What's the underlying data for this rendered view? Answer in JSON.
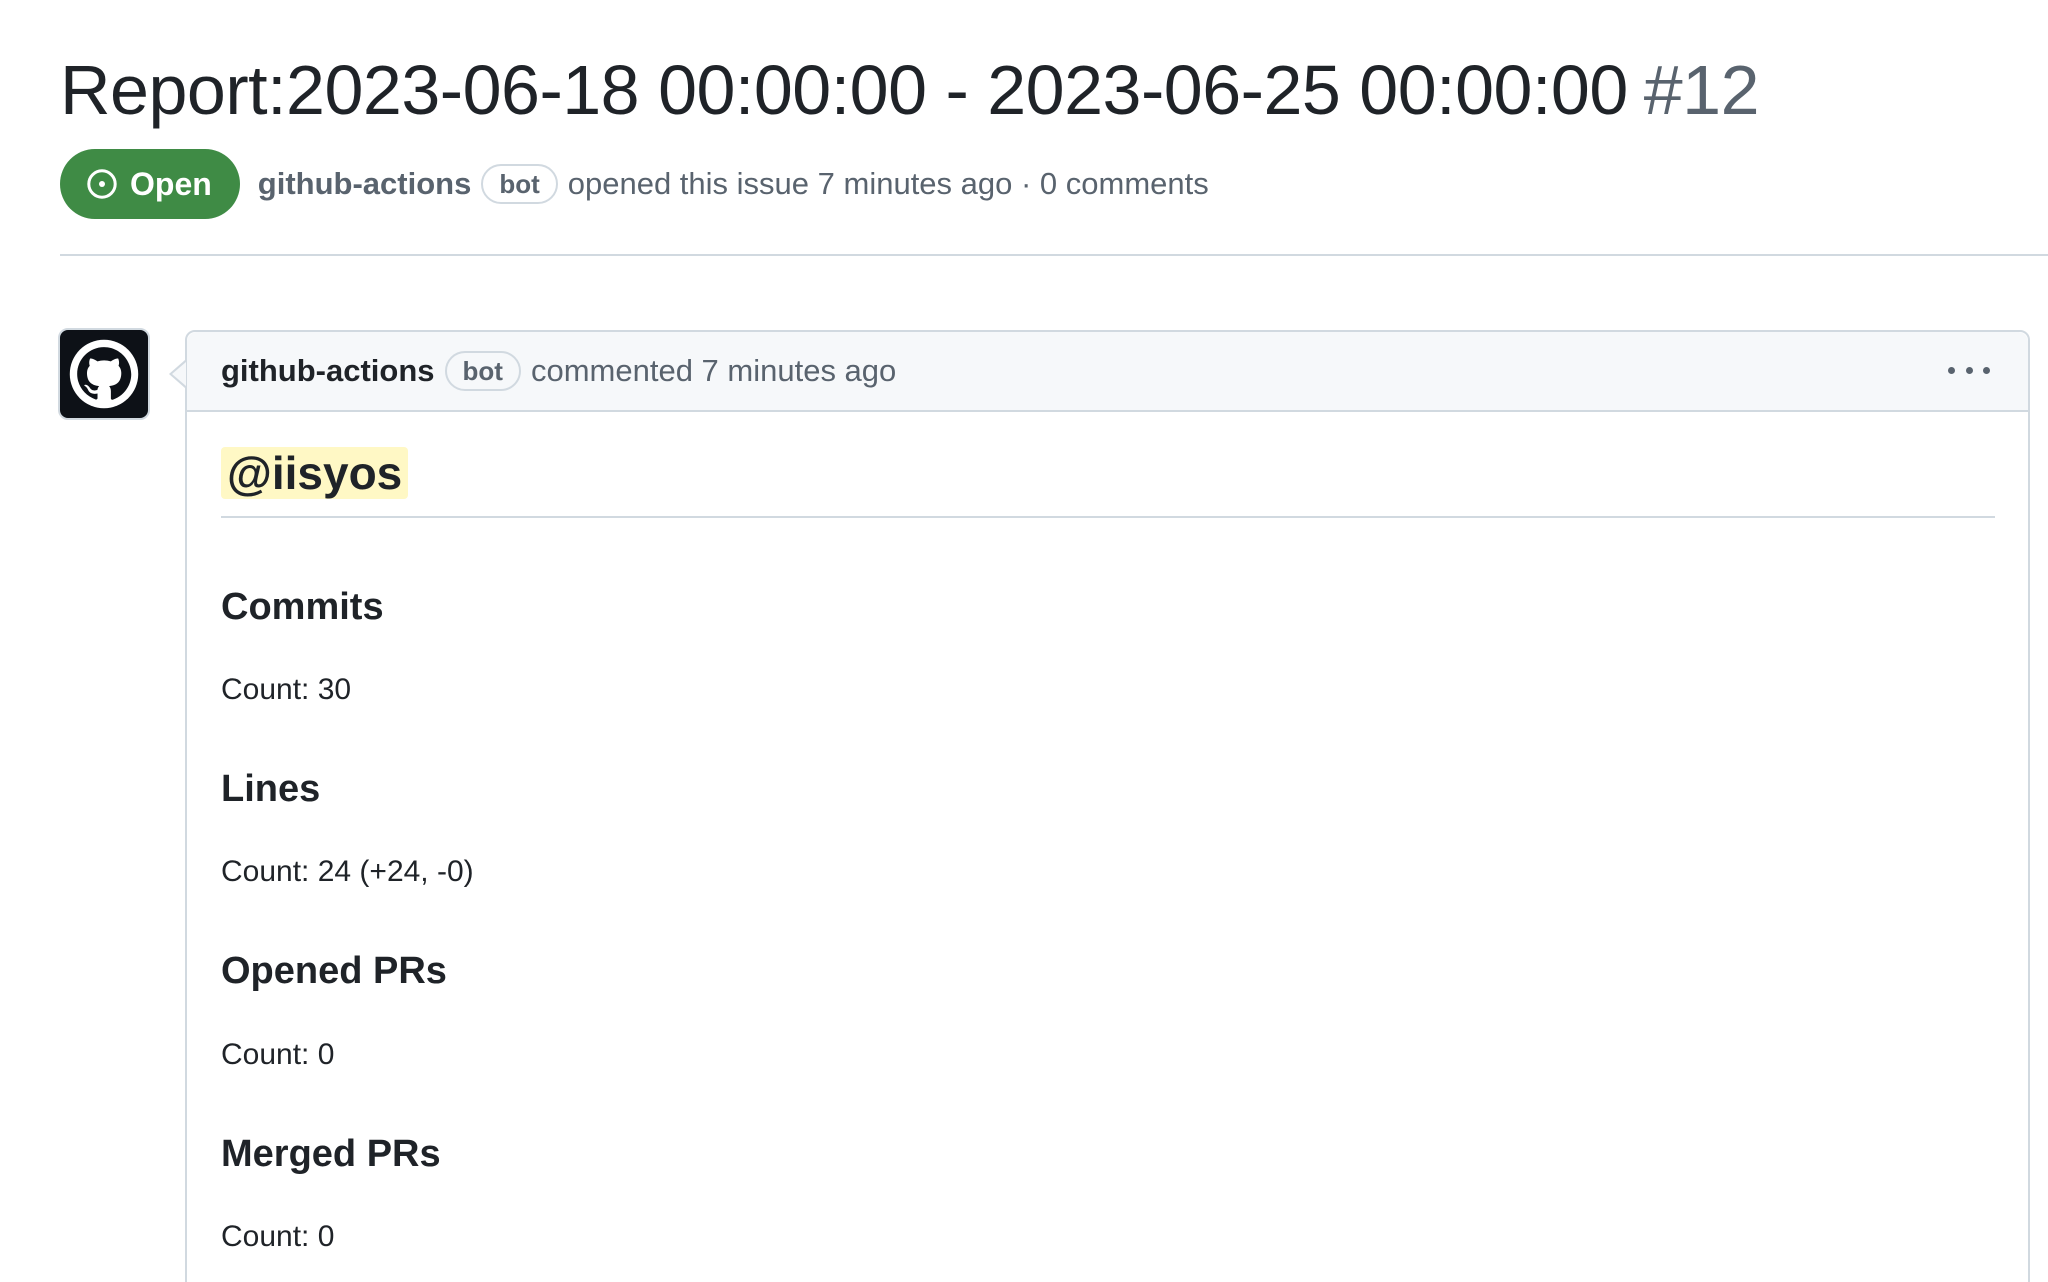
{
  "issue": {
    "title": "Report:2023-06-18 00:00:00 - 2023-06-25 00:00:00",
    "number": "#12",
    "state": "Open",
    "author": "github-actions",
    "author_label": "bot",
    "opened_text": "opened this issue 7 minutes ago · 0 comments"
  },
  "comment": {
    "author": "github-actions",
    "author_label": "bot",
    "timestamp_text": "commented 7 minutes ago",
    "mention": "@iisyos",
    "sections": [
      {
        "title": "Commits",
        "value": "Count: 30"
      },
      {
        "title": "Lines",
        "value": "Count: 24 (+24, -0)"
      },
      {
        "title": "Opened PRs",
        "value": "Count: 0"
      },
      {
        "title": "Merged PRs",
        "value": "Count: 0"
      }
    ]
  },
  "colors": {
    "open_badge": "#3f8b45",
    "mention_highlight": "#fff8c5",
    "border": "#d1d9e0",
    "muted_text": "#59636e"
  },
  "icons": {
    "state": "issue-opened-icon",
    "avatar": "github-mark-icon",
    "menu": "kebab-horizontal-icon"
  }
}
